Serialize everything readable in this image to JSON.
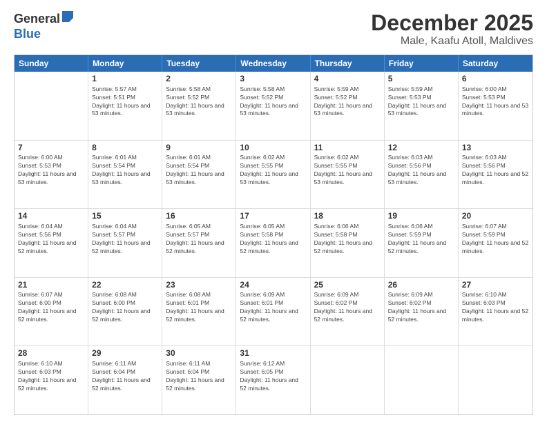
{
  "header": {
    "logo": {
      "general": "General",
      "blue": "Blue"
    },
    "title": "December 2025",
    "subtitle": "Male, Kaafu Atoll, Maldives"
  },
  "calendar": {
    "days_of_week": [
      "Sunday",
      "Monday",
      "Tuesday",
      "Wednesday",
      "Thursday",
      "Friday",
      "Saturday"
    ],
    "weeks": [
      [
        {
          "day": "",
          "sunrise": "",
          "sunset": "",
          "daylight": ""
        },
        {
          "day": "1",
          "sunrise": "Sunrise: 5:57 AM",
          "sunset": "Sunset: 5:51 PM",
          "daylight": "Daylight: 11 hours and 53 minutes."
        },
        {
          "day": "2",
          "sunrise": "Sunrise: 5:58 AM",
          "sunset": "Sunset: 5:52 PM",
          "daylight": "Daylight: 11 hours and 53 minutes."
        },
        {
          "day": "3",
          "sunrise": "Sunrise: 5:58 AM",
          "sunset": "Sunset: 5:52 PM",
          "daylight": "Daylight: 11 hours and 53 minutes."
        },
        {
          "day": "4",
          "sunrise": "Sunrise: 5:59 AM",
          "sunset": "Sunset: 5:52 PM",
          "daylight": "Daylight: 11 hours and 53 minutes."
        },
        {
          "day": "5",
          "sunrise": "Sunrise: 5:59 AM",
          "sunset": "Sunset: 5:53 PM",
          "daylight": "Daylight: 11 hours and 53 minutes."
        },
        {
          "day": "6",
          "sunrise": "Sunrise: 6:00 AM",
          "sunset": "Sunset: 5:53 PM",
          "daylight": "Daylight: 11 hours and 53 minutes."
        }
      ],
      [
        {
          "day": "7",
          "sunrise": "Sunrise: 6:00 AM",
          "sunset": "Sunset: 5:53 PM",
          "daylight": "Daylight: 11 hours and 53 minutes."
        },
        {
          "day": "8",
          "sunrise": "Sunrise: 6:01 AM",
          "sunset": "Sunset: 5:54 PM",
          "daylight": "Daylight: 11 hours and 53 minutes."
        },
        {
          "day": "9",
          "sunrise": "Sunrise: 6:01 AM",
          "sunset": "Sunset: 5:54 PM",
          "daylight": "Daylight: 11 hours and 53 minutes."
        },
        {
          "day": "10",
          "sunrise": "Sunrise: 6:02 AM",
          "sunset": "Sunset: 5:55 PM",
          "daylight": "Daylight: 11 hours and 53 minutes."
        },
        {
          "day": "11",
          "sunrise": "Sunrise: 6:02 AM",
          "sunset": "Sunset: 5:55 PM",
          "daylight": "Daylight: 11 hours and 53 minutes."
        },
        {
          "day": "12",
          "sunrise": "Sunrise: 6:03 AM",
          "sunset": "Sunset: 5:56 PM",
          "daylight": "Daylight: 11 hours and 53 minutes."
        },
        {
          "day": "13",
          "sunrise": "Sunrise: 6:03 AM",
          "sunset": "Sunset: 5:56 PM",
          "daylight": "Daylight: 11 hours and 52 minutes."
        }
      ],
      [
        {
          "day": "14",
          "sunrise": "Sunrise: 6:04 AM",
          "sunset": "Sunset: 5:56 PM",
          "daylight": "Daylight: 11 hours and 52 minutes."
        },
        {
          "day": "15",
          "sunrise": "Sunrise: 6:04 AM",
          "sunset": "Sunset: 5:57 PM",
          "daylight": "Daylight: 11 hours and 52 minutes."
        },
        {
          "day": "16",
          "sunrise": "Sunrise: 6:05 AM",
          "sunset": "Sunset: 5:57 PM",
          "daylight": "Daylight: 11 hours and 52 minutes."
        },
        {
          "day": "17",
          "sunrise": "Sunrise: 6:05 AM",
          "sunset": "Sunset: 5:58 PM",
          "daylight": "Daylight: 11 hours and 52 minutes."
        },
        {
          "day": "18",
          "sunrise": "Sunrise: 6:06 AM",
          "sunset": "Sunset: 5:58 PM",
          "daylight": "Daylight: 11 hours and 52 minutes."
        },
        {
          "day": "19",
          "sunrise": "Sunrise: 6:06 AM",
          "sunset": "Sunset: 5:59 PM",
          "daylight": "Daylight: 11 hours and 52 minutes."
        },
        {
          "day": "20",
          "sunrise": "Sunrise: 6:07 AM",
          "sunset": "Sunset: 5:59 PM",
          "daylight": "Daylight: 11 hours and 52 minutes."
        }
      ],
      [
        {
          "day": "21",
          "sunrise": "Sunrise: 6:07 AM",
          "sunset": "Sunset: 6:00 PM",
          "daylight": "Daylight: 11 hours and 52 minutes."
        },
        {
          "day": "22",
          "sunrise": "Sunrise: 6:08 AM",
          "sunset": "Sunset: 6:00 PM",
          "daylight": "Daylight: 11 hours and 52 minutes."
        },
        {
          "day": "23",
          "sunrise": "Sunrise: 6:08 AM",
          "sunset": "Sunset: 6:01 PM",
          "daylight": "Daylight: 11 hours and 52 minutes."
        },
        {
          "day": "24",
          "sunrise": "Sunrise: 6:09 AM",
          "sunset": "Sunset: 6:01 PM",
          "daylight": "Daylight: 11 hours and 52 minutes."
        },
        {
          "day": "25",
          "sunrise": "Sunrise: 6:09 AM",
          "sunset": "Sunset: 6:02 PM",
          "daylight": "Daylight: 11 hours and 52 minutes."
        },
        {
          "day": "26",
          "sunrise": "Sunrise: 6:09 AM",
          "sunset": "Sunset: 6:02 PM",
          "daylight": "Daylight: 11 hours and 52 minutes."
        },
        {
          "day": "27",
          "sunrise": "Sunrise: 6:10 AM",
          "sunset": "Sunset: 6:03 PM",
          "daylight": "Daylight: 11 hours and 52 minutes."
        }
      ],
      [
        {
          "day": "28",
          "sunrise": "Sunrise: 6:10 AM",
          "sunset": "Sunset: 6:03 PM",
          "daylight": "Daylight: 11 hours and 52 minutes."
        },
        {
          "day": "29",
          "sunrise": "Sunrise: 6:11 AM",
          "sunset": "Sunset: 6:04 PM",
          "daylight": "Daylight: 11 hours and 52 minutes."
        },
        {
          "day": "30",
          "sunrise": "Sunrise: 6:11 AM",
          "sunset": "Sunset: 6:04 PM",
          "daylight": "Daylight: 11 hours and 52 minutes."
        },
        {
          "day": "31",
          "sunrise": "Sunrise: 6:12 AM",
          "sunset": "Sunset: 6:05 PM",
          "daylight": "Daylight: 11 hours and 52 minutes."
        },
        {
          "day": "",
          "sunrise": "",
          "sunset": "",
          "daylight": ""
        },
        {
          "day": "",
          "sunrise": "",
          "sunset": "",
          "daylight": ""
        },
        {
          "day": "",
          "sunrise": "",
          "sunset": "",
          "daylight": ""
        }
      ]
    ]
  }
}
